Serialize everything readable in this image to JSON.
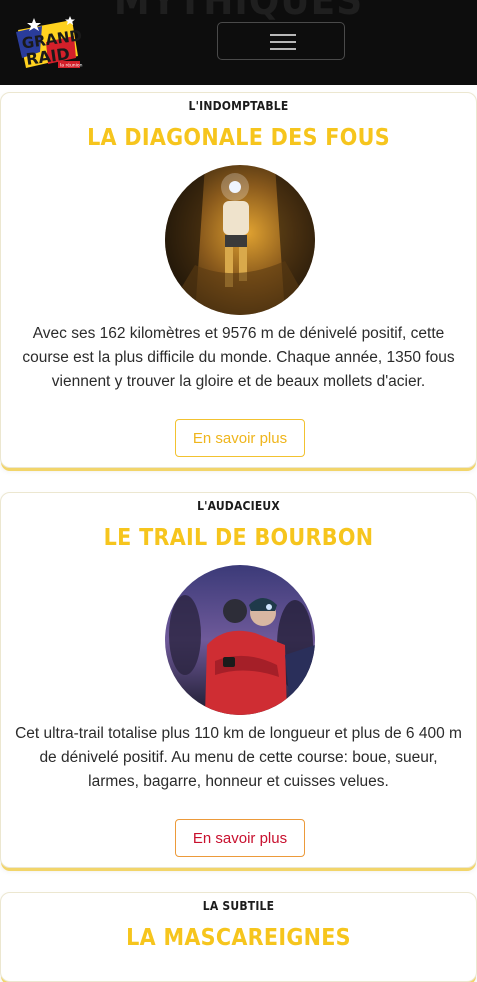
{
  "header": {
    "background_heading": "MYTHIQUES",
    "logo": {
      "line1": "GRAND",
      "line2": "RAID",
      "tag": "la réunion"
    },
    "menu_toggle": "hamburger-icon"
  },
  "races": [
    {
      "kicker": "L'INDOMPTABLE",
      "title": "LA DIAGONALE DES FOUS",
      "description": "Avec ses 162 kilomètres et 9576 m de dénivelé positif, cette course est la plus difficile du monde. Chaque année, 1350 fous viennent y trouver la gloire et de beaux mollets d'acier.",
      "button": "En savoir plus"
    },
    {
      "kicker": "L'AUDACIEUX",
      "title": "LE TRAIL DE BOURBON",
      "description": "Cet ultra-trail totalise plus 110 km de longueur et plus de 6 400 m de dénivelé positif. Au menu de cette course: boue, sueur, larmes, bagarre, honneur et cuisses velues.",
      "button": "En savoir plus"
    },
    {
      "kicker": "LA SUBTILE",
      "title": "LA MASCAREIGNES"
    }
  ],
  "colors": {
    "accent_gold": "#f6c51d",
    "button_red_text": "#c8102e",
    "navbar": "#0d0d0d"
  }
}
